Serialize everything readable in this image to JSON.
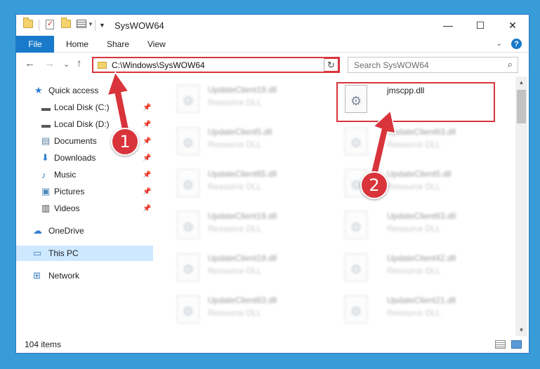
{
  "titlebar": {
    "title": "SysWOW64",
    "qa_icons": [
      "folder-icon",
      "properties-icon",
      "new-folder-icon",
      "view-icon"
    ],
    "minimize_glyph": "—",
    "maximize_glyph": "☐",
    "close_glyph": "✕"
  },
  "ribbon": {
    "tabs": [
      "File",
      "Home",
      "Share",
      "View"
    ],
    "expand_glyph": "⌄",
    "help_glyph": "?"
  },
  "addressbar": {
    "back_glyph": "←",
    "forward_glyph": "→",
    "recent_glyph": "⌄",
    "up_glyph": "↑",
    "path": "C:\\Windows\\SysWOW64",
    "dropdown_glyph": "⌄",
    "refresh_glyph": "↻",
    "search_placeholder": "Search SysWOW64",
    "search_glyph": "⌕"
  },
  "nav": {
    "items": [
      {
        "label": "Quick access",
        "icon": "★"
      },
      {
        "label": "Local Disk (C:)",
        "icon": "▬"
      },
      {
        "label": "Local Disk (D:)",
        "icon": "▬"
      },
      {
        "label": "Documents",
        "icon": "▤"
      },
      {
        "label": "Downloads",
        "icon": "⬇"
      },
      {
        "label": "Music",
        "icon": "♪"
      },
      {
        "label": "Pictures",
        "icon": "▣"
      },
      {
        "label": "Videos",
        "icon": "▥"
      },
      {
        "label": "OneDrive",
        "icon": "☁"
      },
      {
        "label": "This PC",
        "icon": "▭"
      },
      {
        "label": "Network",
        "icon": "⊞"
      }
    ],
    "pin_glyph": "📌"
  },
  "files": {
    "left": [
      {
        "name": "UpdateClient19.dll",
        "type": "Resource DLL"
      },
      {
        "name": "UpdateClient5.dll",
        "type": "Resource DLL"
      },
      {
        "name": "UpdateClient65.dll",
        "type": "Resource DLL"
      },
      {
        "name": "UpdateClient19.dll",
        "type": "Resource DLL"
      },
      {
        "name": "UpdateClient19.dll",
        "type": "Resource DLL"
      },
      {
        "name": "UpdateClient63.dll",
        "type": "Resource DLL"
      }
    ],
    "right": [
      {
        "name": "jmscpp.dll",
        "type": ""
      },
      {
        "name": "UpdateClient63.dll",
        "type": "Resource DLL"
      },
      {
        "name": "UpdateClient5.dll",
        "type": "Resource DLL"
      },
      {
        "name": "UpdateClient63.dll",
        "type": "Resource DLL"
      },
      {
        "name": "UpdateClient42.dll",
        "type": "Resource DLL"
      },
      {
        "name": "UpdateClient21.dll",
        "type": "Resource DLL"
      }
    ]
  },
  "scrollbar": {
    "up_glyph": "▲",
    "down_glyph": "▼"
  },
  "status": {
    "item_count": "104 items"
  },
  "callouts": {
    "step1": "1",
    "step2": "2",
    "color": "#d9343b"
  }
}
